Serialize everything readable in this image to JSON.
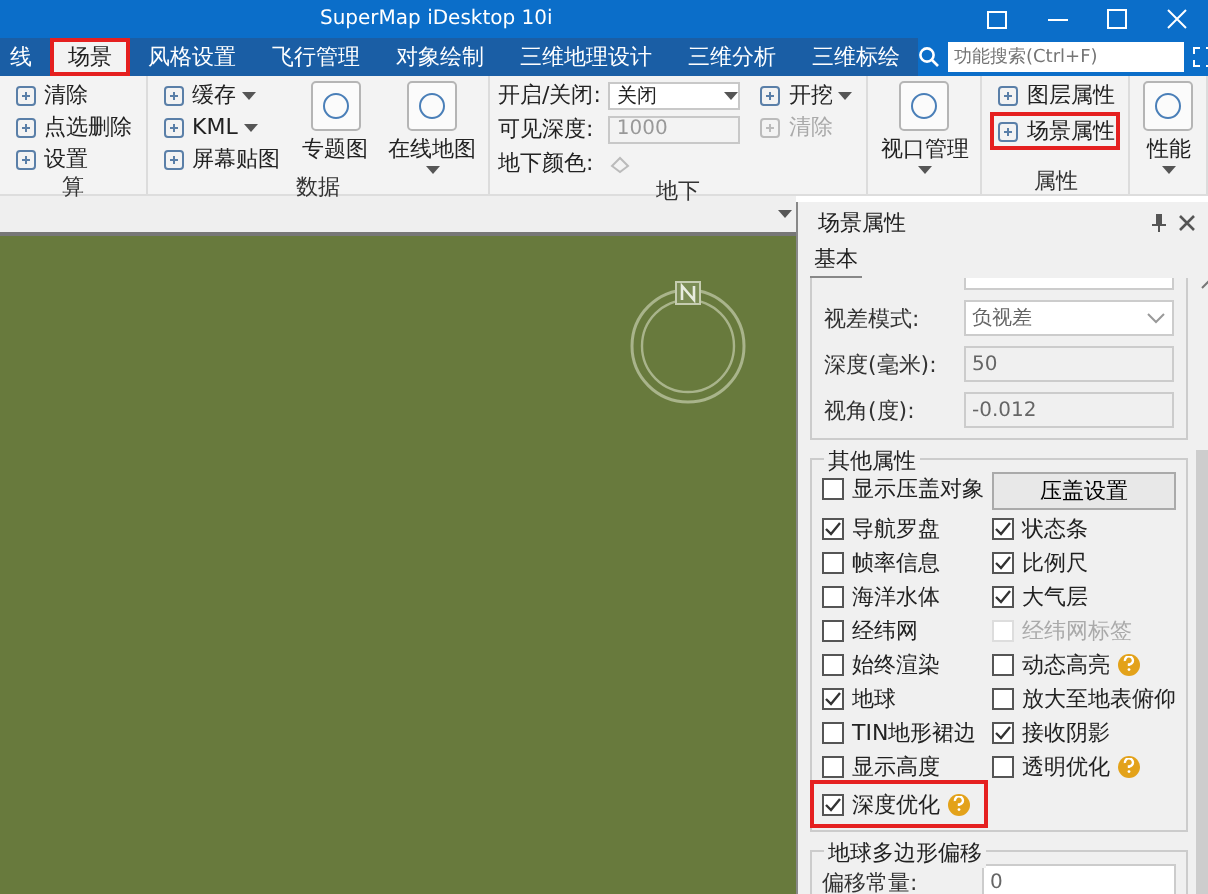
{
  "window": {
    "title": "SuperMap iDesktop 10i"
  },
  "tabs": [
    {
      "label": "线",
      "selected": false,
      "highlighted": false
    },
    {
      "label": "场景",
      "selected": true,
      "highlighted": true
    },
    {
      "label": "风格设置",
      "selected": false,
      "highlighted": false
    },
    {
      "label": "飞行管理",
      "selected": false,
      "highlighted": false
    },
    {
      "label": "对象绘制",
      "selected": false,
      "highlighted": false
    },
    {
      "label": "三维地理设计",
      "selected": false,
      "highlighted": false
    },
    {
      "label": "三维分析",
      "selected": false,
      "highlighted": false
    },
    {
      "label": "三维标绘",
      "selected": false,
      "highlighted": false
    }
  ],
  "search": {
    "placeholder": "功能搜索(Ctrl+F)"
  },
  "ribbon": [
    {
      "label": "算",
      "columns": [
        {
          "kind": "stack",
          "items": [
            {
              "label": "清除",
              "dropdown": false,
              "disabled": false,
              "highlighted": false
            },
            {
              "label": "点选删除",
              "dropdown": false,
              "disabled": false,
              "highlighted": false
            },
            {
              "label": "设置",
              "dropdown": false,
              "disabled": false,
              "highlighted": false
            }
          ]
        }
      ]
    },
    {
      "label": "数据",
      "columns": [
        {
          "kind": "stack",
          "items": [
            {
              "label": "缓存",
              "dropdown": true,
              "disabled": false,
              "highlighted": false
            },
            {
              "label": "KML",
              "dropdown": true,
              "disabled": false,
              "highlighted": false
            },
            {
              "label": "屏幕贴图",
              "dropdown": false,
              "disabled": false,
              "highlighted": false
            }
          ]
        },
        {
          "kind": "large",
          "label": "专题图",
          "dropdown": false
        },
        {
          "kind": "large",
          "label": "在线地图",
          "dropdown": true
        }
      ]
    },
    {
      "label": "地下",
      "columns": [
        {
          "kind": "form",
          "rows": [
            {
              "label": "开启/关闭:",
              "field": {
                "kind": "select",
                "value": "关闭",
                "disabled": false
              }
            },
            {
              "label": "可见深度:",
              "field": {
                "kind": "input",
                "value": "1000",
                "disabled": true
              }
            },
            {
              "label": "地下颜色:",
              "field": {
                "kind": "color",
                "disabled": true
              }
            }
          ]
        },
        {
          "kind": "stack",
          "items": [
            {
              "label": "开挖",
              "dropdown": true,
              "disabled": false,
              "highlighted": false
            },
            {
              "label": "清除",
              "dropdown": false,
              "disabled": true,
              "highlighted": false
            }
          ]
        }
      ]
    },
    {
      "columns": [
        {
          "kind": "large",
          "label": "视口管理",
          "dropdown": true
        }
      ]
    },
    {
      "label": "属性",
      "columns": [
        {
          "kind": "stack",
          "items": [
            {
              "label": "图层属性",
              "dropdown": false,
              "disabled": false,
              "highlighted": false
            },
            {
              "label": "场景属性",
              "dropdown": false,
              "disabled": false,
              "highlighted": true
            }
          ]
        }
      ]
    },
    {
      "columns": [
        {
          "kind": "large",
          "label": "性能",
          "dropdown": true
        }
      ]
    }
  ],
  "panel": {
    "title": "场景属性",
    "tab": {
      "label": "基本",
      "selected": true
    },
    "fields": [
      {
        "label": "视差模式:",
        "kind": "select",
        "value": "负视差"
      },
      {
        "label": "深度(毫米):",
        "kind": "input",
        "value": "50"
      },
      {
        "label": "视角(度):",
        "kind": "input",
        "value": "-0.012"
      }
    ],
    "other": {
      "title": "其他属性",
      "cells": [
        {
          "kind": "check",
          "label": "显示压盖对象",
          "checked": false,
          "disabled": false,
          "help": false,
          "highlighted": false
        },
        {
          "kind": "button",
          "label": "压盖设置"
        },
        {
          "kind": "check",
          "label": "导航罗盘",
          "checked": true,
          "disabled": false,
          "help": false,
          "highlighted": false
        },
        {
          "kind": "check",
          "label": "状态条",
          "checked": true,
          "disabled": false,
          "help": false,
          "highlighted": false
        },
        {
          "kind": "check",
          "label": "帧率信息",
          "checked": false,
          "disabled": false,
          "help": false,
          "highlighted": false
        },
        {
          "kind": "check",
          "label": "比例尺",
          "checked": true,
          "disabled": false,
          "help": false,
          "highlighted": false
        },
        {
          "kind": "check",
          "label": "海洋水体",
          "checked": false,
          "disabled": false,
          "help": false,
          "highlighted": false
        },
        {
          "kind": "check",
          "label": "大气层",
          "checked": true,
          "disabled": false,
          "help": false,
          "highlighted": false
        },
        {
          "kind": "check",
          "label": "经纬网",
          "checked": false,
          "disabled": false,
          "help": false,
          "highlighted": false
        },
        {
          "kind": "check",
          "label": "经纬网标签",
          "checked": false,
          "disabled": true,
          "help": false,
          "highlighted": false
        },
        {
          "kind": "check",
          "label": "始终渲染",
          "checked": false,
          "disabled": false,
          "help": false,
          "highlighted": false
        },
        {
          "kind": "check",
          "label": "动态高亮",
          "checked": false,
          "disabled": false,
          "help": true,
          "highlighted": false
        },
        {
          "kind": "check",
          "label": "地球",
          "checked": true,
          "disabled": false,
          "help": false,
          "highlighted": false
        },
        {
          "kind": "check",
          "label": "放大至地表俯仰",
          "checked": false,
          "disabled": false,
          "help": false,
          "highlighted": false
        },
        {
          "kind": "check",
          "label": "TIN地形裙边",
          "checked": false,
          "disabled": false,
          "help": false,
          "highlighted": false
        },
        {
          "kind": "check",
          "label": "接收阴影",
          "checked": true,
          "disabled": false,
          "help": false,
          "highlighted": false
        },
        {
          "kind": "check",
          "label": "显示高度",
          "checked": false,
          "disabled": false,
          "help": false,
          "highlighted": false
        },
        {
          "kind": "check",
          "label": "透明优化",
          "checked": false,
          "disabled": false,
          "help": true,
          "highlighted": false
        },
        {
          "kind": "check",
          "label": "深度优化",
          "checked": true,
          "disabled": false,
          "help": true,
          "highlighted": true
        }
      ]
    },
    "offset": {
      "title": "地球多边形偏移",
      "label": "偏移常量:",
      "value": "0"
    }
  }
}
